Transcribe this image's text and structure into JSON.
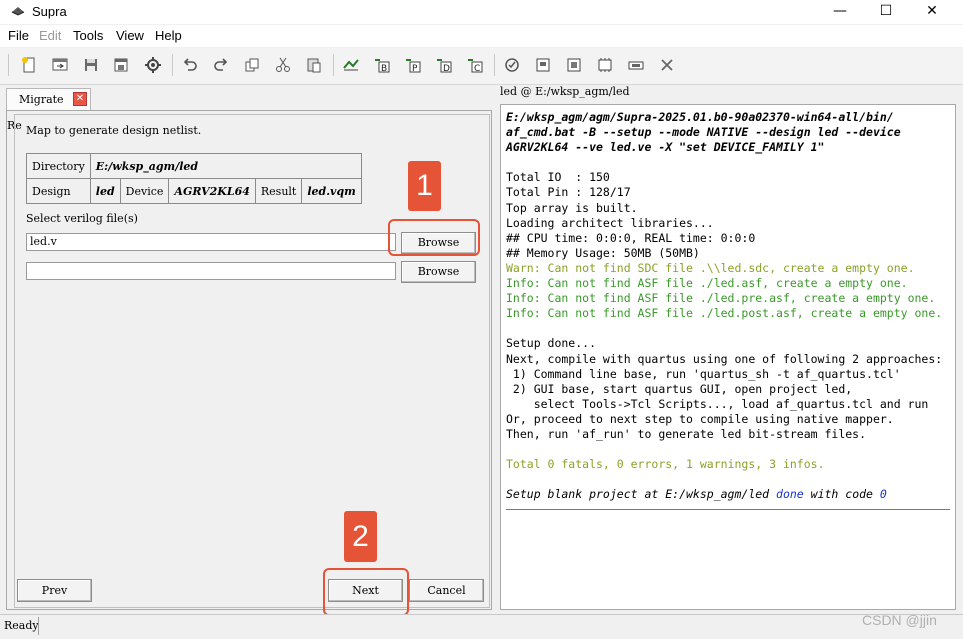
{
  "window": {
    "title": "Supra",
    "buttons": {
      "minimize": "—",
      "maximize": "☐",
      "close": "✕"
    }
  },
  "menu": [
    "File",
    "Edit",
    "Tools",
    "View",
    "Help"
  ],
  "menu_disabled": [
    "Edit"
  ],
  "toolbar": {
    "icons": [
      "new-project-icon",
      "open-project-icon",
      "save-icon",
      "save-as-icon",
      "settings-icon",
      "undo-icon",
      "redo-icon",
      "copy-icon",
      "cut-icon",
      "paste-icon",
      "migrate-icon",
      "run-b-icon",
      "run-p-icon",
      "run-d-icon",
      "run-c-icon",
      "check-icon",
      "program-icon",
      "chip-icon",
      "chip-dots-icon",
      "device-icon",
      "close-icon"
    ]
  },
  "left_panel": {
    "tab_label": "Migrate",
    "cut_text": "Re",
    "description": "Map to generate design netlist.",
    "table": {
      "directory_label": "Directory",
      "directory_value": "E:/wksp_agm/led",
      "design_label": "Design",
      "design_value": "led",
      "device_label": "Device",
      "device_value": "AGRV2KL64",
      "result_label": "Result",
      "result_value": "led.vqm"
    },
    "select_label": "Select verilog file(s)",
    "file1_value": "led.v",
    "file2_value": "",
    "browse1_label": "Browse",
    "browse2_label": "Browse",
    "prev_label": "Prev",
    "next_label": "Next",
    "cancel_label": "Cancel"
  },
  "annotations": {
    "first": "1",
    "second": "2"
  },
  "console": {
    "title": "led @ E:/wksp_agm/led",
    "lines": [
      {
        "text": "E:/wksp_agm/agm/Supra-2025.01.b0-90a02370-win64-all/bin/",
        "style": "bi"
      },
      {
        "text": "af_cmd.bat -B --setup --mode NATIVE --design led --device",
        "style": "bi"
      },
      {
        "text": "AGRV2KL64 --ve led.ve -X \"set DEVICE_FAMILY 1\"",
        "style": "bi"
      },
      {
        "text": "",
        "style": ""
      },
      {
        "text": "Total IO  : 150",
        "style": ""
      },
      {
        "text": "Total Pin : 128/17",
        "style": ""
      },
      {
        "text": "Top array is built.",
        "style": ""
      },
      {
        "text": "Loading architect libraries...",
        "style": ""
      },
      {
        "text": "## CPU time: 0:0:0, REAL time: 0:0:0",
        "style": ""
      },
      {
        "text": "## Memory Usage: 50MB (50MB)",
        "style": ""
      },
      {
        "text": "Warn: Can not find SDC file .\\\\led.sdc, create a empty one.",
        "style": "olive"
      },
      {
        "text": "Info: Can not find ASF file ./led.asf, create a empty one.",
        "style": "green"
      },
      {
        "text": "Info: Can not find ASF file ./led.pre.asf, create a empty one.",
        "style": "green"
      },
      {
        "text": "Info: Can not find ASF file ./led.post.asf, create a empty one.",
        "style": "green"
      },
      {
        "text": "",
        "style": ""
      },
      {
        "text": "Setup done...",
        "style": ""
      },
      {
        "text": "Next, compile with quartus using one of following 2 approaches:",
        "style": ""
      },
      {
        "text": " 1) Command line base, run 'quartus_sh -t af_quartus.tcl'",
        "style": ""
      },
      {
        "text": " 2) GUI base, start quartus GUI, open project led,",
        "style": ""
      },
      {
        "text": "    select Tools->Tcl Scripts..., load af_quartus.tcl and run",
        "style": ""
      },
      {
        "text": "Or, proceed to next step to compile using native mapper.",
        "style": ""
      },
      {
        "text": "Then, run 'af_run' to generate led bit-stream files.",
        "style": ""
      },
      {
        "text": "",
        "style": ""
      },
      {
        "text": "Total 0 fatals, 0 errors, 1 warnings, 3 infos.",
        "style": "olive"
      },
      {
        "text": "",
        "style": ""
      }
    ],
    "final": {
      "prefix": "Setup blank project at E:/wksp_agm/led ",
      "done": "done",
      "mid": " with code ",
      "code": "0"
    }
  },
  "status": {
    "text": "Ready"
  },
  "watermark": "CSDN @jjin",
  "colors": {
    "annotation": "#e55436",
    "info_green": "#3a9a2a",
    "warn_olive": "#8aa328",
    "link_blue": "#1a33d6"
  }
}
